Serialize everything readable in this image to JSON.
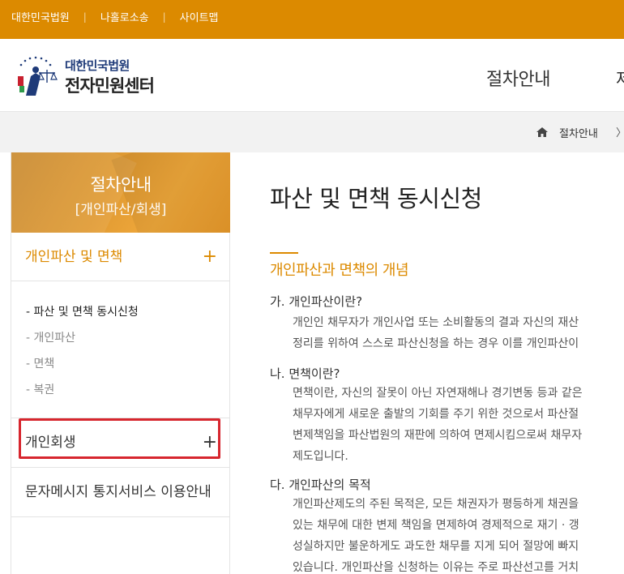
{
  "topbar": {
    "links": [
      "대한민국법원",
      "나홀로소송",
      "사이트맵"
    ],
    "separator": "|"
  },
  "header": {
    "logo_small": "대한민국법원",
    "logo_big": "전자민원센터",
    "nav": [
      "절차안내",
      "제"
    ]
  },
  "breadcrumb": {
    "items": [
      "절차안내"
    ],
    "arrow": "〉"
  },
  "sidebar": {
    "title": "절차안내",
    "subtitle": "[개인파산/회생]",
    "groups": [
      {
        "label": "개인파산 및 면책",
        "toggle": "+",
        "items": [
          "- 파산 및 면책 동시신청",
          "- 개인파산",
          "- 면책",
          "- 복권"
        ]
      },
      {
        "label": "개인회생",
        "toggle": "+"
      },
      {
        "label": "문자메시지 통지서비스 이용안내"
      }
    ]
  },
  "main": {
    "title": "파산 및 면책 동시신청",
    "section": "개인파산과 면책의 개념",
    "blocks": [
      {
        "head": "가.  개인파산이란?",
        "lines": [
          "개인인 채무자가 개인사업 또는 소비활동의 결과 자신의 재산",
          "정리를 위하여 스스로 파산신청을 하는 경우 이를 개인파산이"
        ]
      },
      {
        "head": "나.  면책이란?",
        "lines": [
          "면책이란, 자신의 잘못이 아닌 자연재해나 경기변동 등과 같은",
          "채무자에게 새로운 출발의 기회를 주기 위한 것으로서 파산절",
          "변제책임을 파산법원의 재판에 의하여 면제시킴으로써 채무자",
          "제도입니다."
        ]
      },
      {
        "head": "다.  개인파산의 목적",
        "lines": [
          "개인파산제도의 주된 목적은, 모든 채권자가 평등하게 채권을",
          "있는 채무에 대한 변제 책임을 면제하여 경제적으로 재기 · 갱",
          "성실하지만 불운하게도 과도한 채무를 지게 되어 절망에 빠지",
          "있습니다. 개인파산을 신청하는 이유는 주로 파산선고를 거치"
        ]
      }
    ]
  },
  "colors": {
    "accent": "#dc8a00",
    "highlight": "#d7262e"
  }
}
